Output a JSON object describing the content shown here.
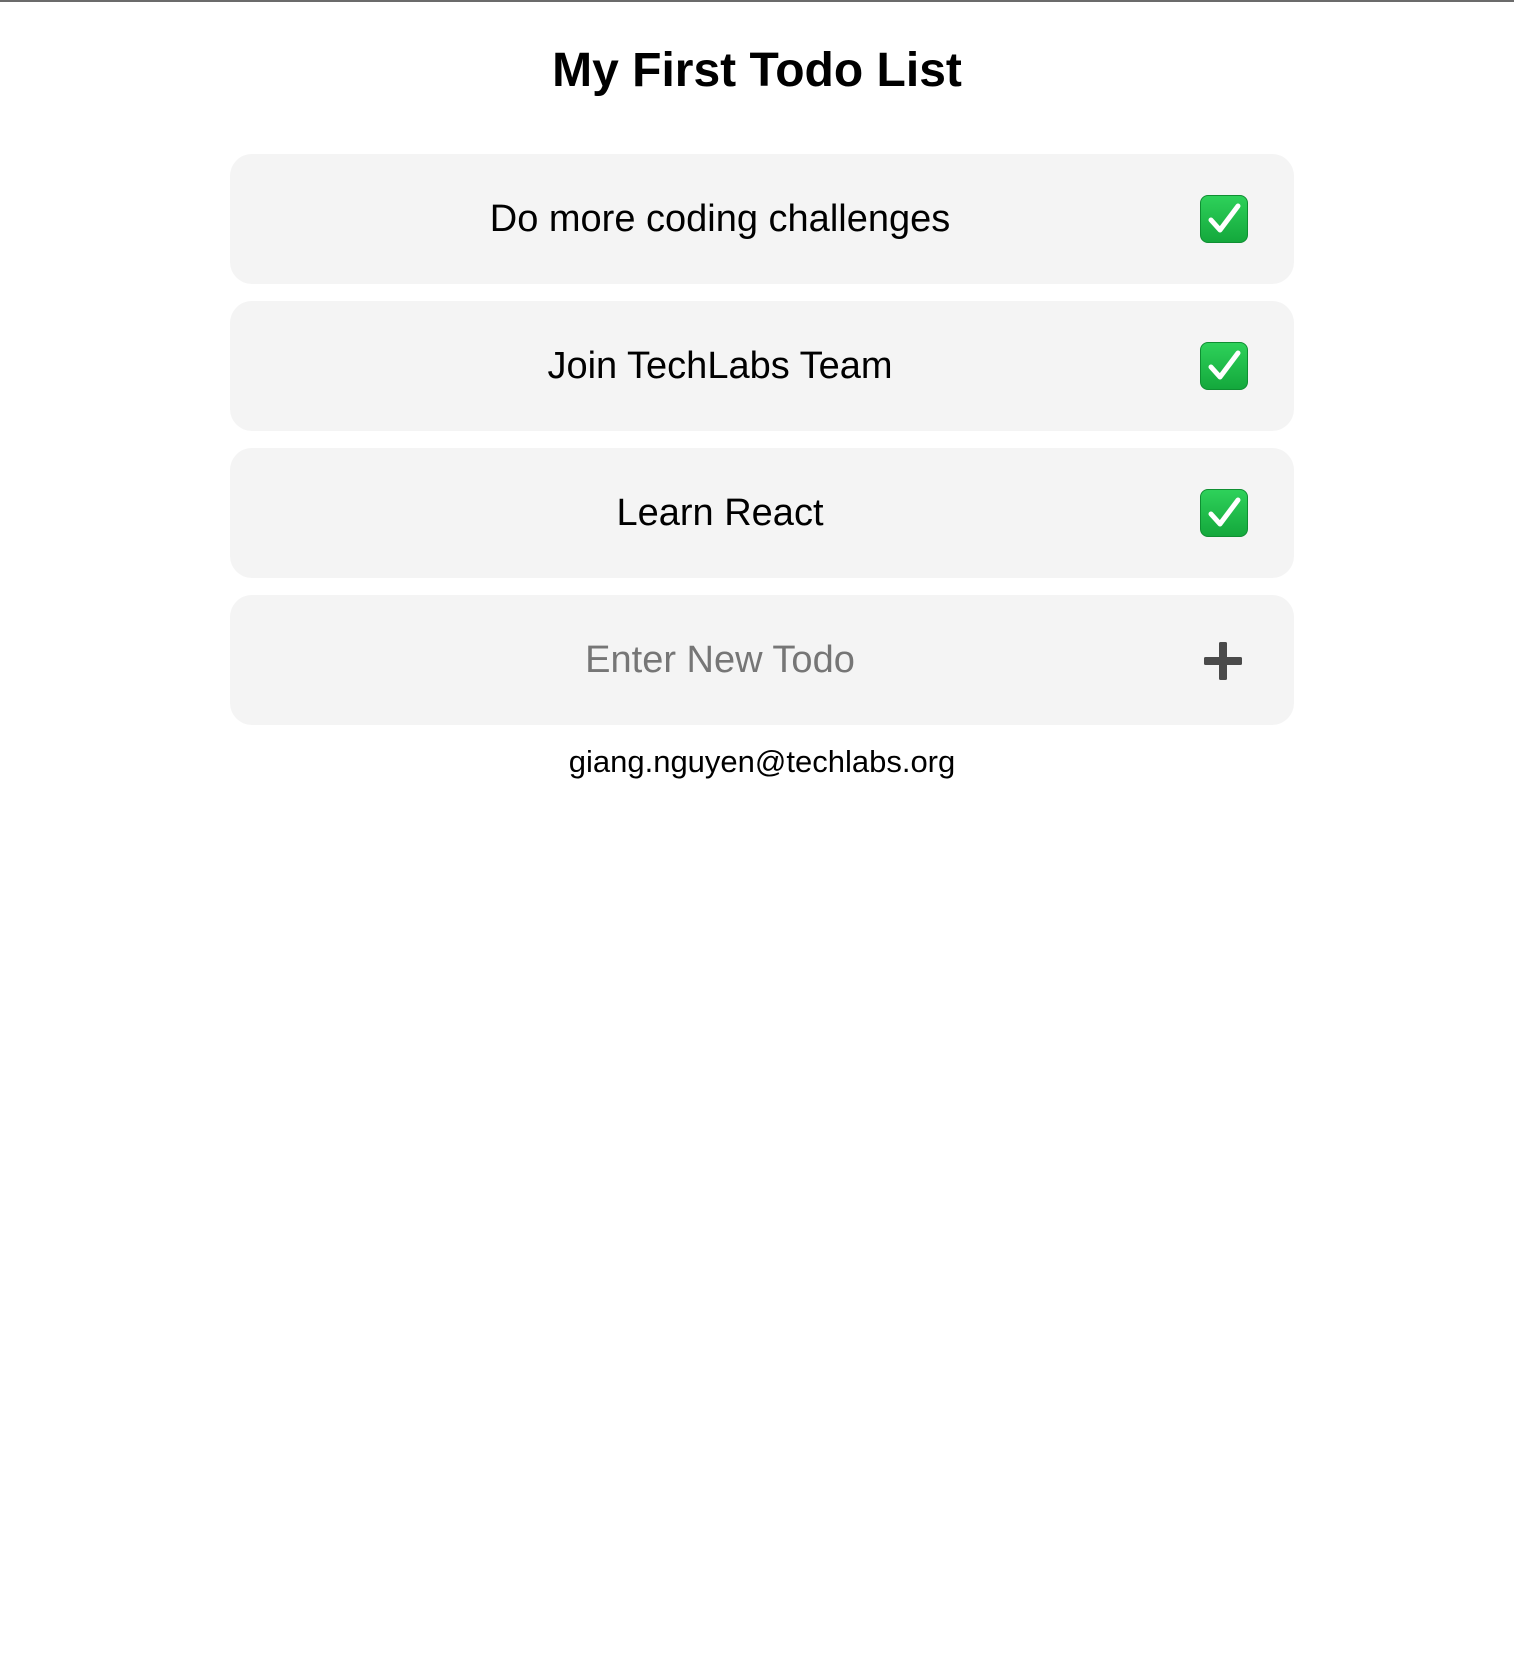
{
  "header": {
    "title": "My First Todo List"
  },
  "todos": [
    {
      "text": "Do more coding challenges",
      "done": true,
      "icon": "check-mark-button-icon"
    },
    {
      "text": "Join TechLabs Team",
      "done": true,
      "icon": "check-mark-button-icon"
    },
    {
      "text": "Learn React",
      "done": true,
      "icon": "check-mark-button-icon"
    }
  ],
  "new_todo": {
    "placeholder": "Enter New Todo",
    "value": "",
    "add_icon": "plus-icon"
  },
  "footer": {
    "email": "giang.nguyen@techlabs.org"
  },
  "colors": {
    "card_background": "#f4f4f4",
    "check_green": "#1fbf4a",
    "placeholder": "#767676",
    "plus": "#4a4a4a"
  }
}
